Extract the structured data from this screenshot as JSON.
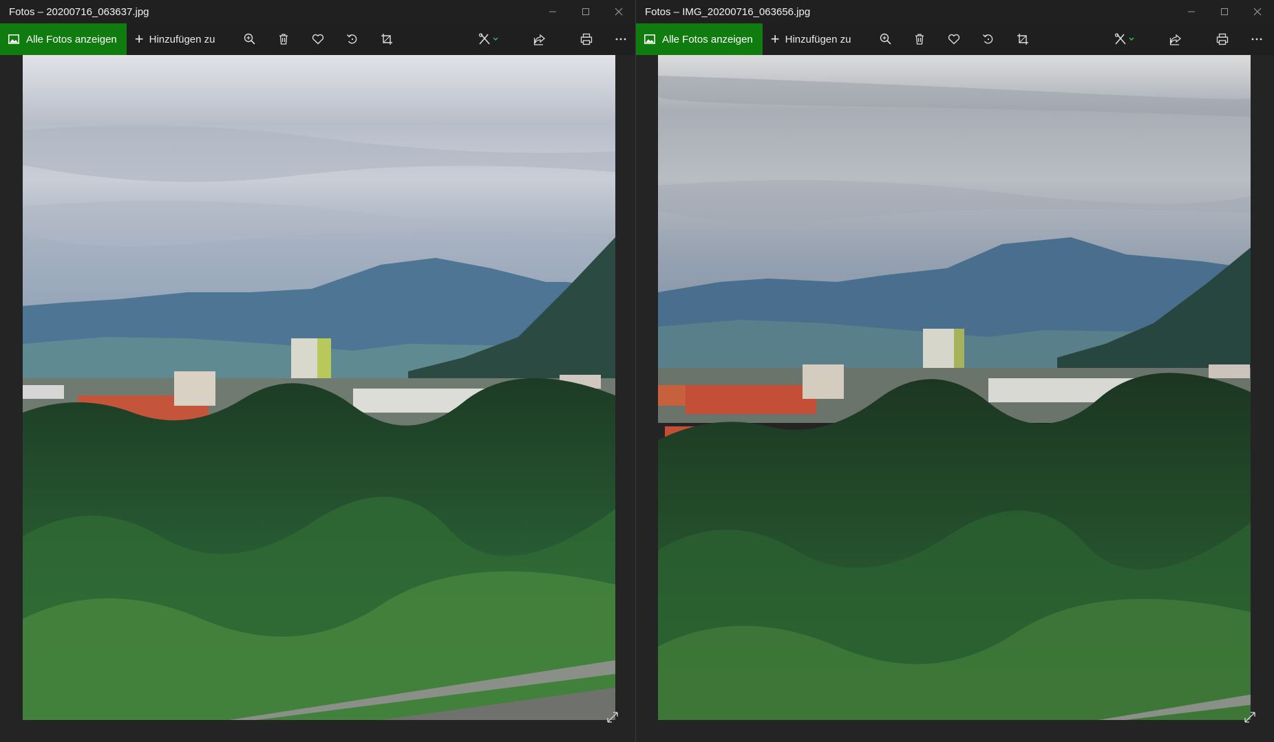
{
  "windows": [
    {
      "title": "Fotos – 20200716_063637.jpg",
      "toolbar": {
        "all_photos_label": "Alle Fotos anzeigen",
        "add_to_label": "Hinzufügen zu",
        "icons": [
          "zoom-in-icon",
          "delete-icon",
          "favorite-icon",
          "rotate-icon",
          "crop-icon",
          "edit-draw-icon",
          "share-icon",
          "print-icon",
          "more-icon"
        ]
      }
    },
    {
      "title": "Fotos – IMG_20200716_063656.jpg",
      "toolbar": {
        "all_photos_label": "Alle Fotos anzeigen",
        "add_to_label": "Hinzufügen zu",
        "icons": [
          "zoom-in-icon",
          "delete-icon",
          "favorite-icon",
          "rotate-icon",
          "crop-icon",
          "edit-draw-icon",
          "share-icon",
          "print-icon",
          "more-icon"
        ]
      }
    }
  ],
  "colors": {
    "accent": "#107c10",
    "background": "#242424",
    "titlebar": "#202020"
  }
}
